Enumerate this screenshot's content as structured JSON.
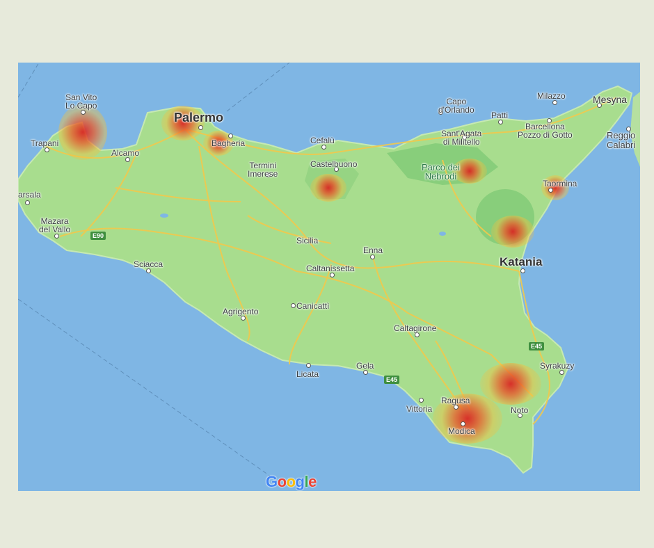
{
  "map": {
    "region": "Sicilia",
    "labels": {
      "san_vito": "San Vito\nLo Capo",
      "trapani": "Trapani",
      "alcamo": "Alcamo",
      "palermo": "Palermo",
      "bagheria": "Bagheria",
      "termini": "Termini\nImerese",
      "cefalu": "Cefalù",
      "castelbuono": "Castelbuono",
      "capo_orlando": "Capo\nd'Orlando",
      "patti": "Patti",
      "milazzo": "Milazzo",
      "mesyna": "Mesyna",
      "reggio": "Reggio\nCalabri",
      "barcellona": "Barcellona\nPozzo di Gotto",
      "sant_agata": "Sant'Agata\ndi Militello",
      "parco_nebrodi": "Parco dei\nNebrodi",
      "taormina": "Taormina",
      "marsala": "arsala",
      "mazara": "Mazara\ndel Vallo",
      "sicilia": "Sicilia",
      "enna": "Enna",
      "caltanissetta": "Caltanissetta",
      "katania": "Katania",
      "sciacca": "Sciacca",
      "agrigento": "Agrigento",
      "canicatti": "Canicattì",
      "caltagirone": "Caltagirone",
      "licata": "Licata",
      "gela": "Gela",
      "syrakuzy": "Syrakuzy",
      "vittoria": "Vittoria",
      "ragusa": "Ragusa",
      "modica": "Modica",
      "noto": "Noto"
    },
    "shields": {
      "e90": "E90",
      "e45_east": "E45",
      "e45_south": "E45"
    },
    "heat_spots": [
      {
        "name": "San Vito Lo Capo",
        "intensity": 0.9
      },
      {
        "name": "Palermo",
        "intensity": 0.85
      },
      {
        "name": "Bagheria",
        "intensity": 0.6
      },
      {
        "name": "Castelbuono",
        "intensity": 0.7
      },
      {
        "name": "Parco dei Nebrodi",
        "intensity": 0.65
      },
      {
        "name": "Taormina",
        "intensity": 0.6
      },
      {
        "name": "Etna",
        "intensity": 0.75
      },
      {
        "name": "Noto area",
        "intensity": 0.85
      },
      {
        "name": "Modica",
        "intensity": 0.9
      }
    ],
    "attribution": "Google",
    "colors": {
      "sea": "#7fb6e4",
      "land": "#a8dd8e",
      "roads": "#f2c94c",
      "heat_core": "#dc1e1e"
    }
  }
}
